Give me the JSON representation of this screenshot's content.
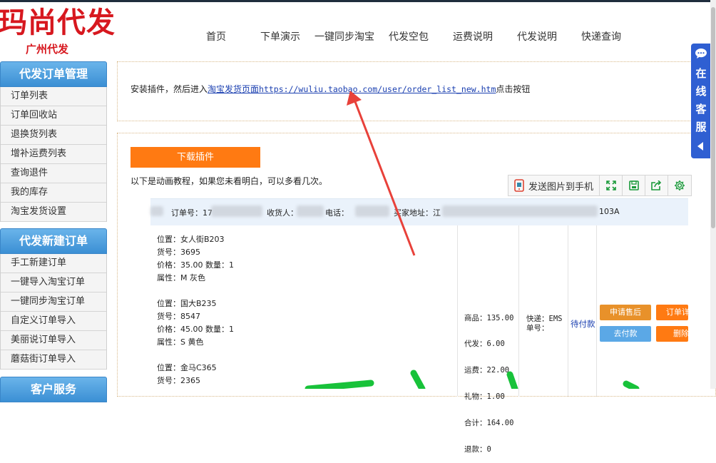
{
  "header": {
    "logo_title": "玛尚代发",
    "logo_subtitle": "广州代发",
    "nav": [
      "首页",
      "下单演示",
      "一键同步淘宝",
      "代发空包",
      "运费说明",
      "代发说明",
      "快递查询"
    ]
  },
  "sidebar": {
    "section1": {
      "title": "代发订单管理",
      "items": [
        "订单列表",
        "订单回收站",
        "退换货列表",
        "增补运费列表",
        "查询退件",
        "我的库存",
        "淘宝发货设置"
      ]
    },
    "section2": {
      "title": "代发新建订单",
      "items": [
        "手工新建订单",
        "一键导入淘宝订单",
        "一键同步淘宝订单",
        "自定义订单导入",
        "美丽说订单导入",
        "蘑菇街订单导入"
      ]
    },
    "section3": {
      "title": "客户服务"
    }
  },
  "instructions": {
    "prefix": "安装插件，然后进入",
    "link_text": "淘宝发货页面",
    "url": "https://wuliu.taobao.com/user/order_list_new.htm",
    "suffix": "点击按钮"
  },
  "download": {
    "button": "下载插件",
    "tip": "以下是动画教程，如果您未看明白，可以多看几次。"
  },
  "image_toolbar": {
    "send_to_phone": "发送图片到手机",
    "icons": [
      "phone-icon",
      "expand-icon",
      "save-icon",
      "share-icon",
      "settings-icon"
    ]
  },
  "order": {
    "order_no_label": "订单号：",
    "order_no_prefix": "17",
    "receiver_label": "收货人：",
    "phone_label": "电话：",
    "address_label": "买家地址：",
    "address_prefix": "江",
    "address_suffix": "103A",
    "items": [
      {
        "location": "位置：女人街B203",
        "sku": "货号：3695",
        "price_qty": "价格：35.00  数量：1",
        "attr": "属性：M 灰色"
      },
      {
        "location": "位置：国大B235",
        "sku": "货号：8547",
        "price_qty": "价格：45.00  数量：1",
        "attr": "属性：S 黄色"
      },
      {
        "location": "位置：金马C365",
        "sku": "货号：2365"
      }
    ],
    "summary": [
      "商品：135.00",
      "代发：6.00",
      "运费：22.00",
      "礼物：1.00",
      "合计：164.00",
      "退款：0"
    ],
    "shipping": [
      "快递：EMS",
      "单号："
    ],
    "status": "待付款",
    "actions": {
      "after_sale": "申请售后",
      "detail": "订单详",
      "pay": "去付款",
      "delete": "删除"
    }
  },
  "online_service": {
    "label": [
      "在",
      "线",
      "客",
      "服"
    ]
  },
  "colors": {
    "brand_red": "#d7181f",
    "sidebar_blue": "#3b8fd4",
    "download_orange": "#ff7a12",
    "arrow_red": "#e8413a",
    "service_blue": "#2f5fd2",
    "scribble_green": "#18c23a"
  }
}
